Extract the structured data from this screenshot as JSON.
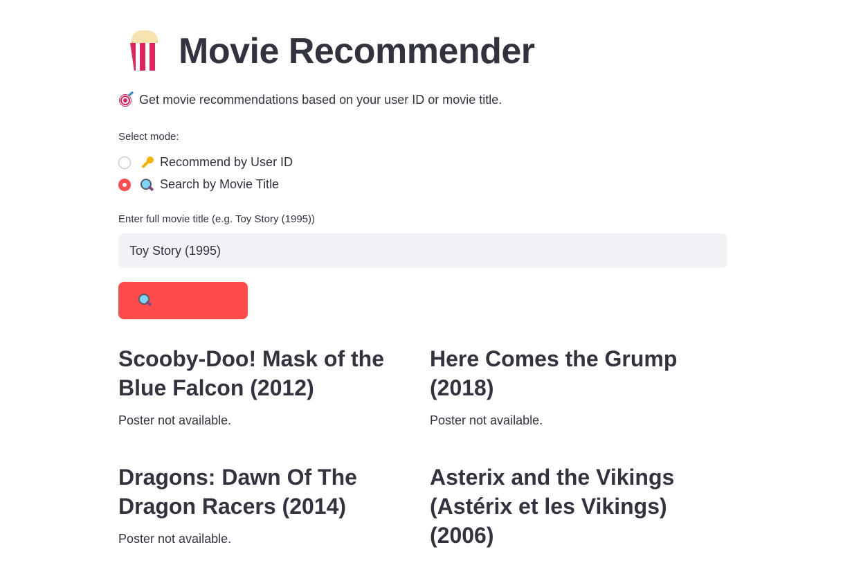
{
  "header": {
    "title": "Movie Recommender",
    "title_icon": "popcorn-icon"
  },
  "subtitle": {
    "icon": "target-icon",
    "text": "Get movie recommendations based on your user ID or movie title."
  },
  "mode": {
    "label": "Select mode:",
    "options": [
      {
        "icon": "key-icon",
        "label": "Recommend by User ID",
        "selected": false
      },
      {
        "icon": "magnifier-icon",
        "label": "Search by Movie Title",
        "selected": true
      }
    ]
  },
  "title_input": {
    "label": "Enter full movie title (e.g. Toy Story (1995))",
    "value": "Toy Story (1995)"
  },
  "search_button": {
    "icon": "magnifier-icon",
    "label": ""
  },
  "recommendations": [
    {
      "title": "Scooby-Doo! Mask of the Blue Falcon (2012)",
      "poster_status": "Poster not available."
    },
    {
      "title": "Here Comes the Grump (2018)",
      "poster_status": "Poster not available."
    },
    {
      "title": "Dragons: Dawn Of The Dragon Racers (2014)",
      "poster_status": "Poster not available."
    },
    {
      "title": "Asterix and the Vikings (Astérix et les Vikings) (2006)",
      "poster_status": ""
    }
  ],
  "colors": {
    "accent": "#ff4b4b",
    "text": "#31333f",
    "input_bg": "#f0f2f6"
  }
}
